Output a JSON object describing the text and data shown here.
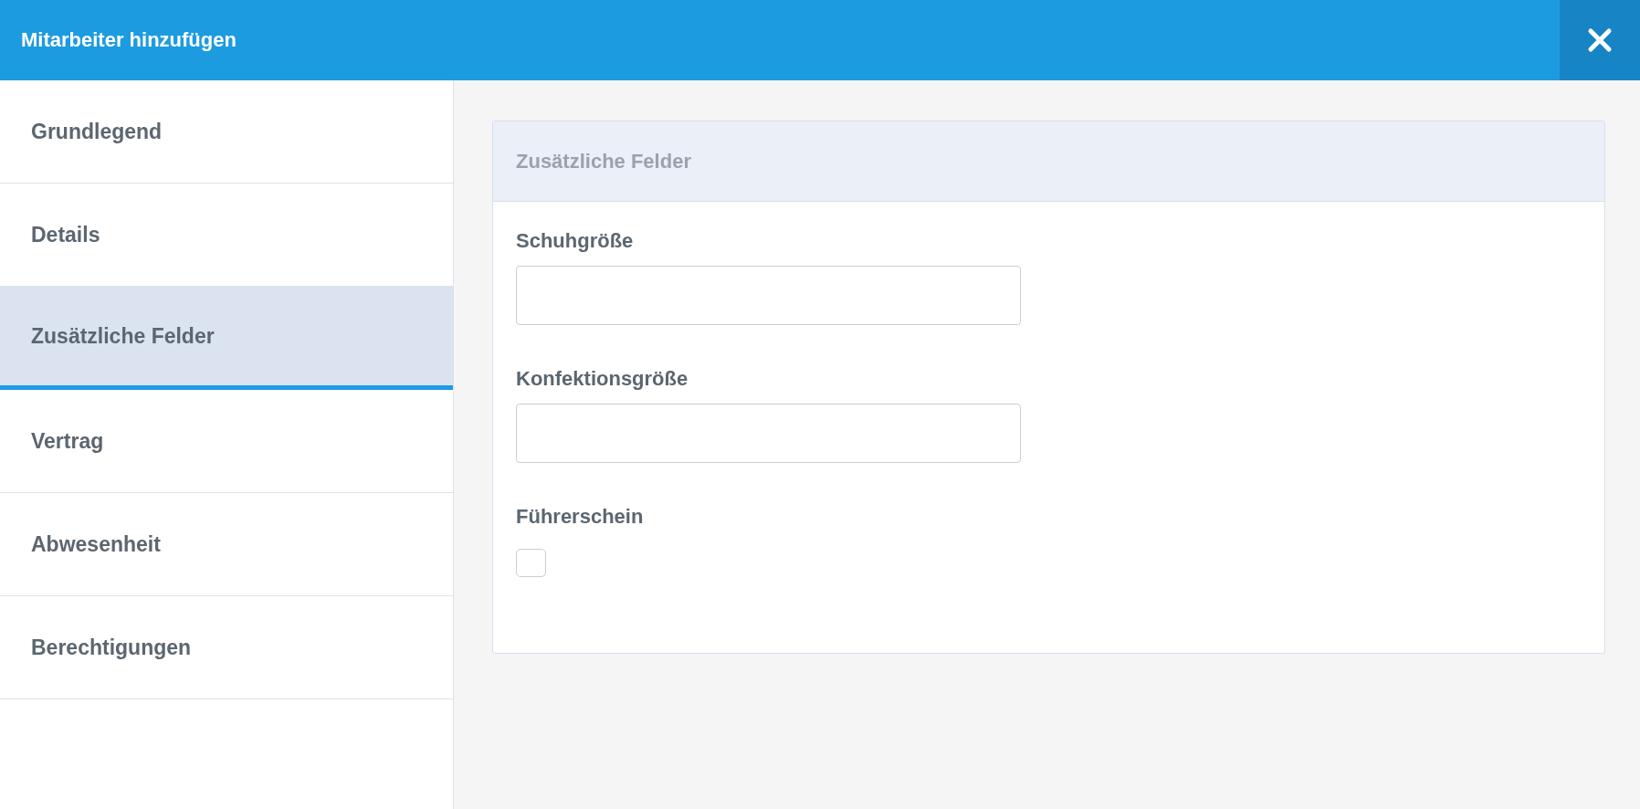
{
  "window": {
    "title": "Mitarbeiter hinzufügen"
  },
  "sidebar": {
    "items": [
      {
        "label": "Grundlegend",
        "selected": false
      },
      {
        "label": "Details",
        "selected": false
      },
      {
        "label": "Zusätzliche Felder",
        "selected": true
      },
      {
        "label": "Vertrag",
        "selected": false
      },
      {
        "label": "Abwesenheit",
        "selected": false
      },
      {
        "label": "Berechtigungen",
        "selected": false
      }
    ]
  },
  "panel": {
    "title": "Zusätzliche Felder",
    "fields": [
      {
        "kind": "text",
        "label": "Schuhgröße"
      },
      {
        "kind": "text",
        "label": "Konfektionsgröße"
      },
      {
        "kind": "checkbox",
        "label": "Führerschein",
        "checked": false
      }
    ]
  }
}
